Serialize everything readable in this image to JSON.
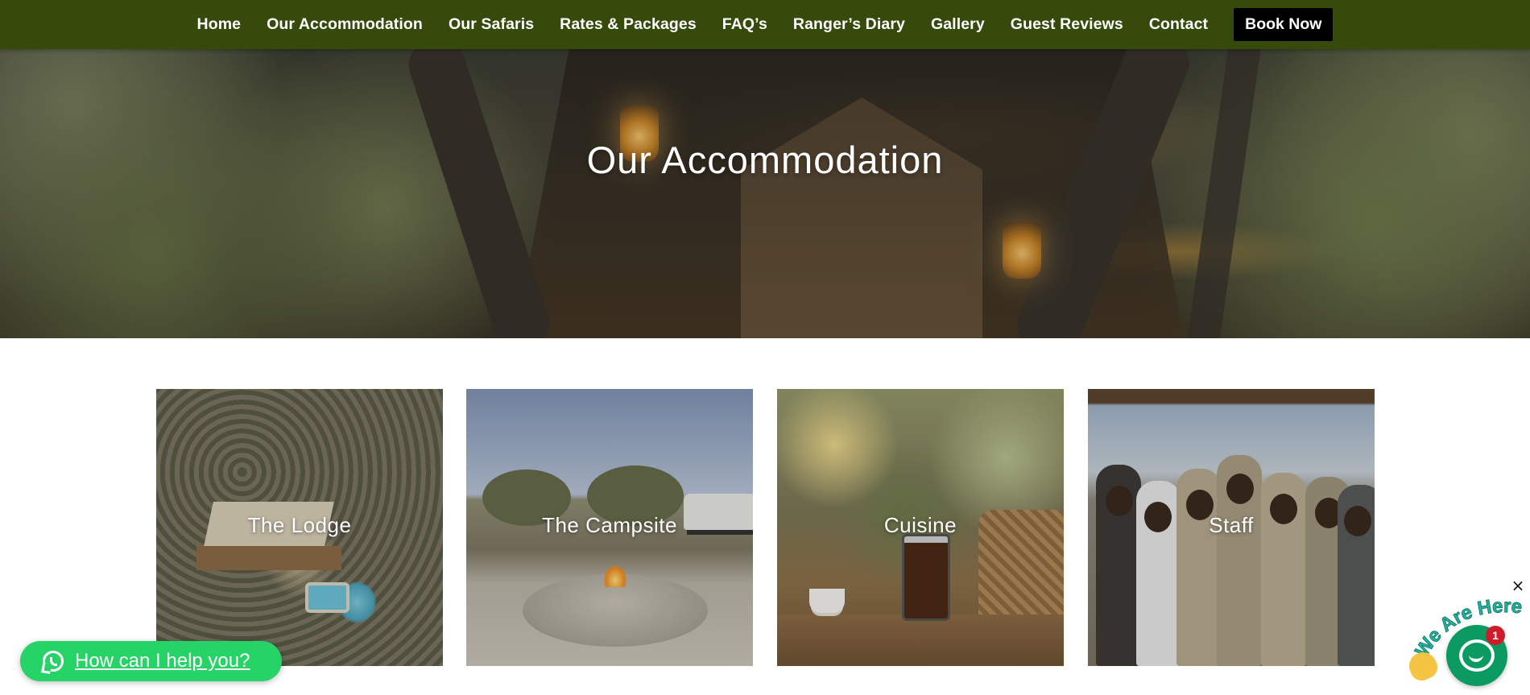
{
  "nav": {
    "items": [
      {
        "label": "Home"
      },
      {
        "label": "Our Accommodation"
      },
      {
        "label": "Our Safaris"
      },
      {
        "label": "Rates & Packages"
      },
      {
        "label": "FAQ’s"
      },
      {
        "label": "Ranger’s Diary"
      },
      {
        "label": "Gallery"
      },
      {
        "label": "Guest Reviews"
      },
      {
        "label": "Contact"
      }
    ],
    "book_label": "Book Now",
    "bg_color": "#354a0b"
  },
  "hero": {
    "title": "Our Accommodation"
  },
  "cards": [
    {
      "label": "The Lodge"
    },
    {
      "label": "The Campsite"
    },
    {
      "label": "Cuisine"
    },
    {
      "label": "Staff"
    }
  ],
  "whatsapp": {
    "label": "How can I help you?",
    "icon": "whatsapp-icon",
    "color": "#25d366"
  },
  "chat_widget": {
    "tagline": "We Are Here!",
    "badge_count": "1",
    "close_label": "×",
    "icon": "chat-icon",
    "color": "#0c9a63"
  }
}
